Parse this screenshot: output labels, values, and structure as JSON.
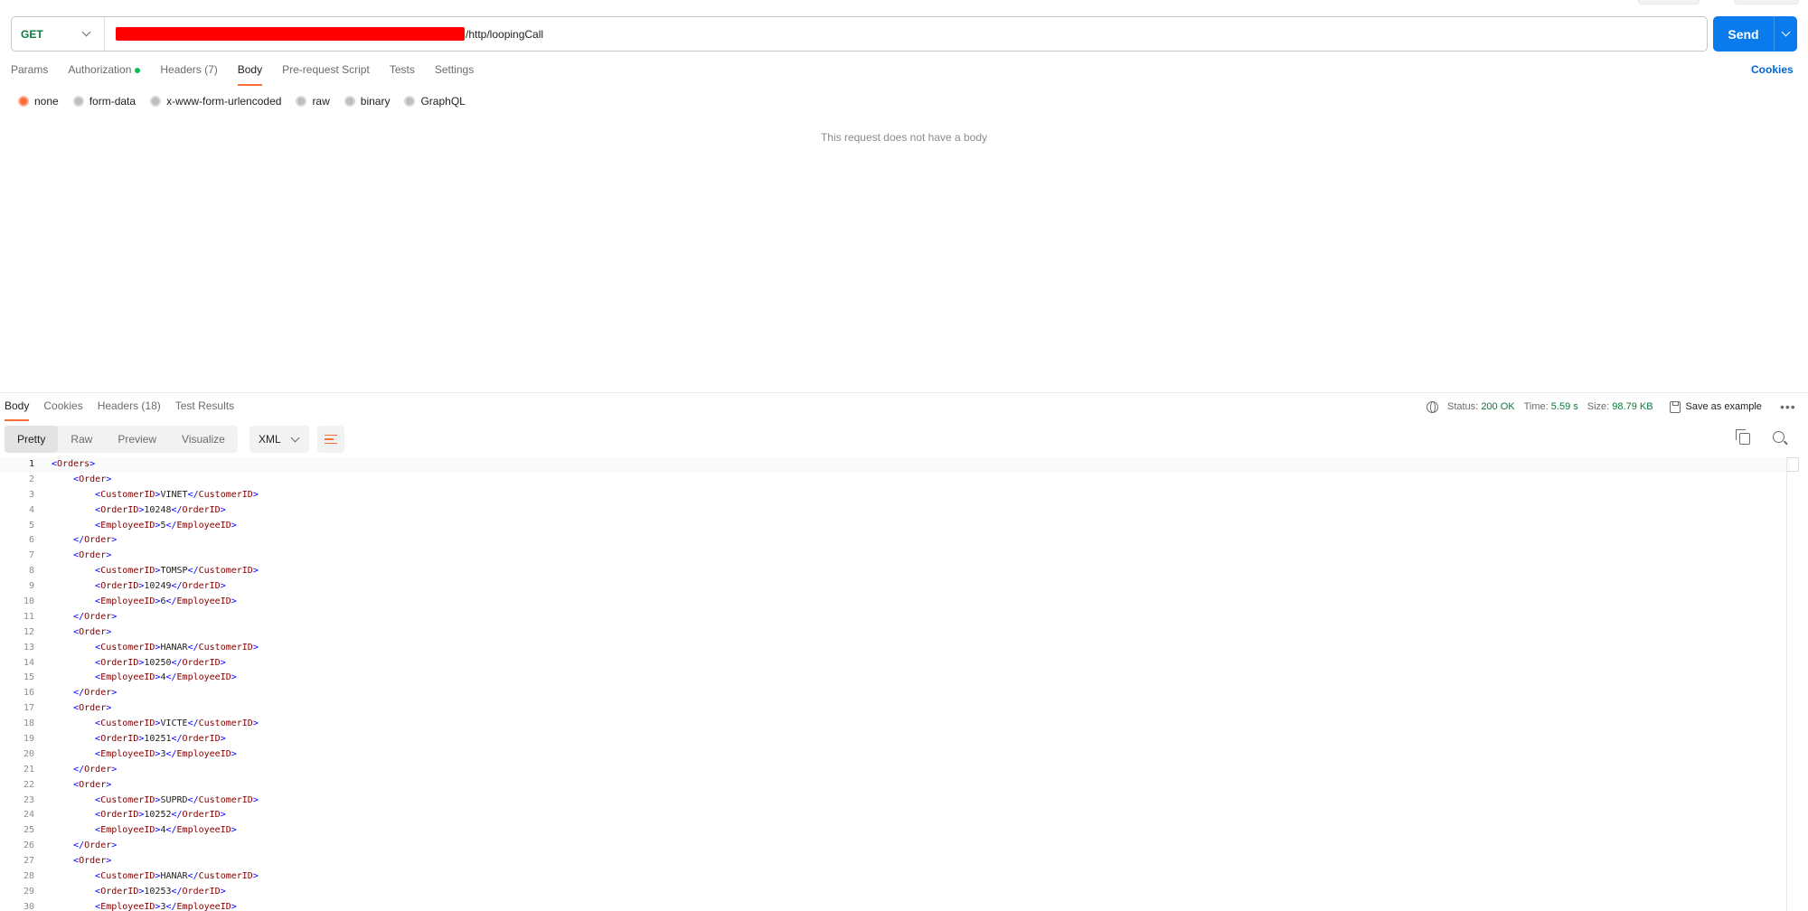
{
  "request": {
    "method": "GET",
    "url_suffix": "/http/loopingCall",
    "send_label": "Send"
  },
  "request_tabs": [
    {
      "label": "Params"
    },
    {
      "label": "Authorization"
    },
    {
      "label": "Headers (7)"
    },
    {
      "label": "Body"
    },
    {
      "label": "Pre-request Script"
    },
    {
      "label": "Tests"
    },
    {
      "label": "Settings"
    }
  ],
  "cookies_label": "Cookies",
  "body_types": [
    {
      "label": "none",
      "selected": true
    },
    {
      "label": "form-data",
      "selected": false
    },
    {
      "label": "x-www-form-urlencoded",
      "selected": false
    },
    {
      "label": "raw",
      "selected": false
    },
    {
      "label": "binary",
      "selected": false
    },
    {
      "label": "GraphQL",
      "selected": false
    }
  ],
  "no_body_text": "This request does not have a body",
  "response": {
    "tabs": [
      {
        "label": "Body"
      },
      {
        "label": "Cookies"
      },
      {
        "label": "Headers (18)"
      },
      {
        "label": "Test Results"
      }
    ],
    "status_label": "Status:",
    "status_value": "200 OK",
    "time_label": "Time:",
    "time_value": "5.59 s",
    "size_label": "Size:",
    "size_value": "98.79 KB",
    "save_label": "Save as example",
    "more_label": "•••",
    "views": [
      {
        "label": "Pretty"
      },
      {
        "label": "Raw"
      },
      {
        "label": "Preview"
      },
      {
        "label": "Visualize"
      }
    ],
    "format": "XML"
  },
  "code_lines": [
    "<Orders>",
    "    <Order>",
    "        <CustomerID>VINET</CustomerID>",
    "        <OrderID>10248</OrderID>",
    "        <EmployeeID>5</EmployeeID>",
    "    </Order>",
    "    <Order>",
    "        <CustomerID>TOMSP</CustomerID>",
    "        <OrderID>10249</OrderID>",
    "        <EmployeeID>6</EmployeeID>",
    "    </Order>",
    "    <Order>",
    "        <CustomerID>HANAR</CustomerID>",
    "        <OrderID>10250</OrderID>",
    "        <EmployeeID>4</EmployeeID>",
    "    </Order>",
    "    <Order>",
    "        <CustomerID>VICTE</CustomerID>",
    "        <OrderID>10251</OrderID>",
    "        <EmployeeID>3</EmployeeID>",
    "    </Order>",
    "    <Order>",
    "        <CustomerID>SUPRD</CustomerID>",
    "        <OrderID>10252</OrderID>",
    "        <EmployeeID>4</EmployeeID>",
    "    </Order>",
    "    <Order>",
    "        <CustomerID>HANAR</CustomerID>",
    "        <OrderID>10253</OrderID>",
    "        <EmployeeID>3</EmployeeID>"
  ],
  "colors": {
    "accent": "#ff6c37",
    "send": "#097bed",
    "method": "#0a7a3c",
    "redaction": "#ff0000",
    "link": "#0265d2"
  }
}
